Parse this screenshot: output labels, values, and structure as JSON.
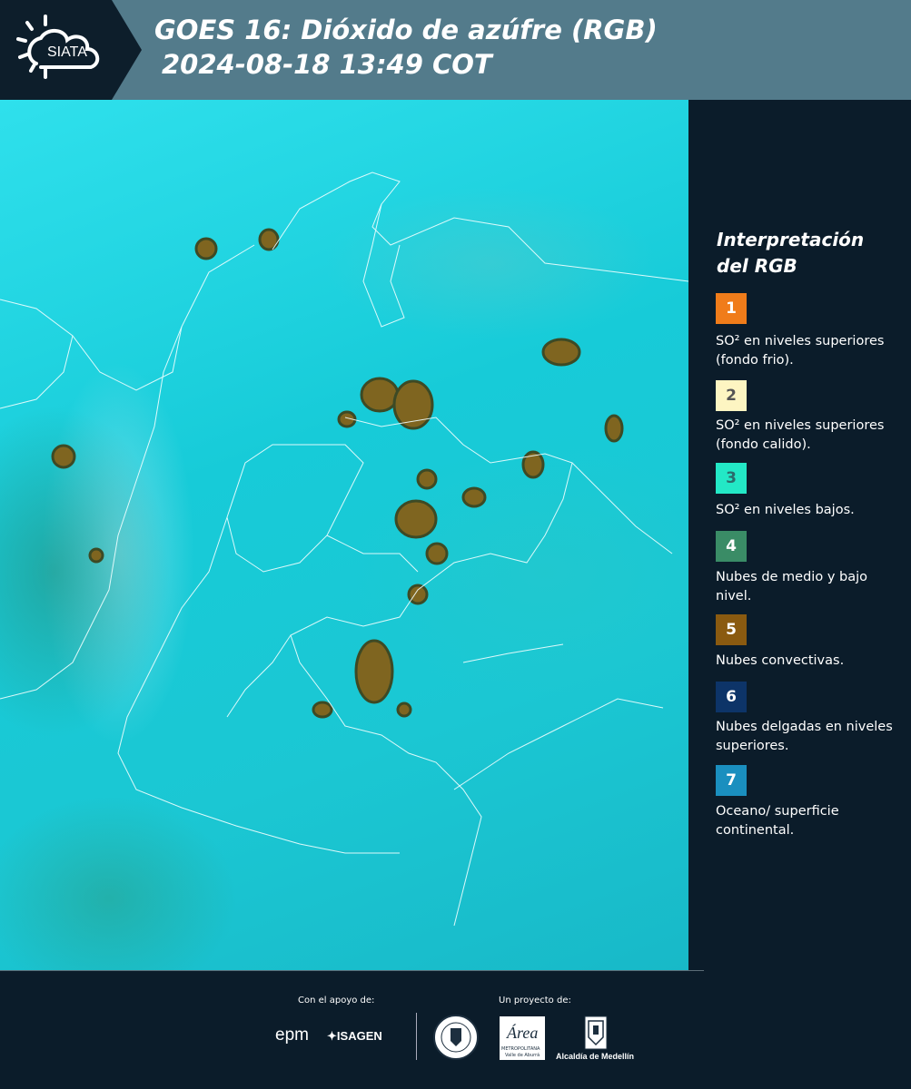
{
  "header": {
    "logo_text": "SIATA",
    "title_line1": "GOES 16: Dióxido de azúfre (RGB)",
    "title_line2": "2024-08-18 13:49 COT"
  },
  "legend": {
    "title_line1": "Interpretación",
    "title_line2": "del RGB",
    "items": [
      {
        "number": "1",
        "color": "#f07c1a",
        "text_color": "#ffffff",
        "text": "SO² en niveles superiores (fondo frio)."
      },
      {
        "number": "2",
        "color": "#fdf5c2",
        "text_color": "#555555",
        "text": "SO² en niveles superiores (fondo calido)."
      },
      {
        "number": "3",
        "color": "#23e8c6",
        "text_color": "#2b6b6b",
        "text": "SO² en niveles bajos."
      },
      {
        "number": "4",
        "color": "#3a8c66",
        "text_color": "#ffffff",
        "text": "Nubes de medio y bajo nivel."
      },
      {
        "number": "5",
        "color": "#8a5a10",
        "text_color": "#ffffff",
        "text": "Nubes convectivas."
      },
      {
        "number": "6",
        "color": "#0d3468",
        "text_color": "#ffffff",
        "text": "Nubes delgadas en niveles superiores."
      },
      {
        "number": "7",
        "color": "#1a8fbf",
        "text_color": "#ffffff",
        "text": "Oceano/ superficie continental."
      }
    ]
  },
  "footer": {
    "support_label": "Con el apoyo de:",
    "project_label": "Un proyecto de:",
    "epm_logo": "epm",
    "isagen_logo": "ISAGEN",
    "area_logo": "Área",
    "area_subtitle": "METROPOLITANA",
    "area_subtitle2": "Valle de Aburrá",
    "medellin_label": "Alcaldía de Medellín"
  }
}
